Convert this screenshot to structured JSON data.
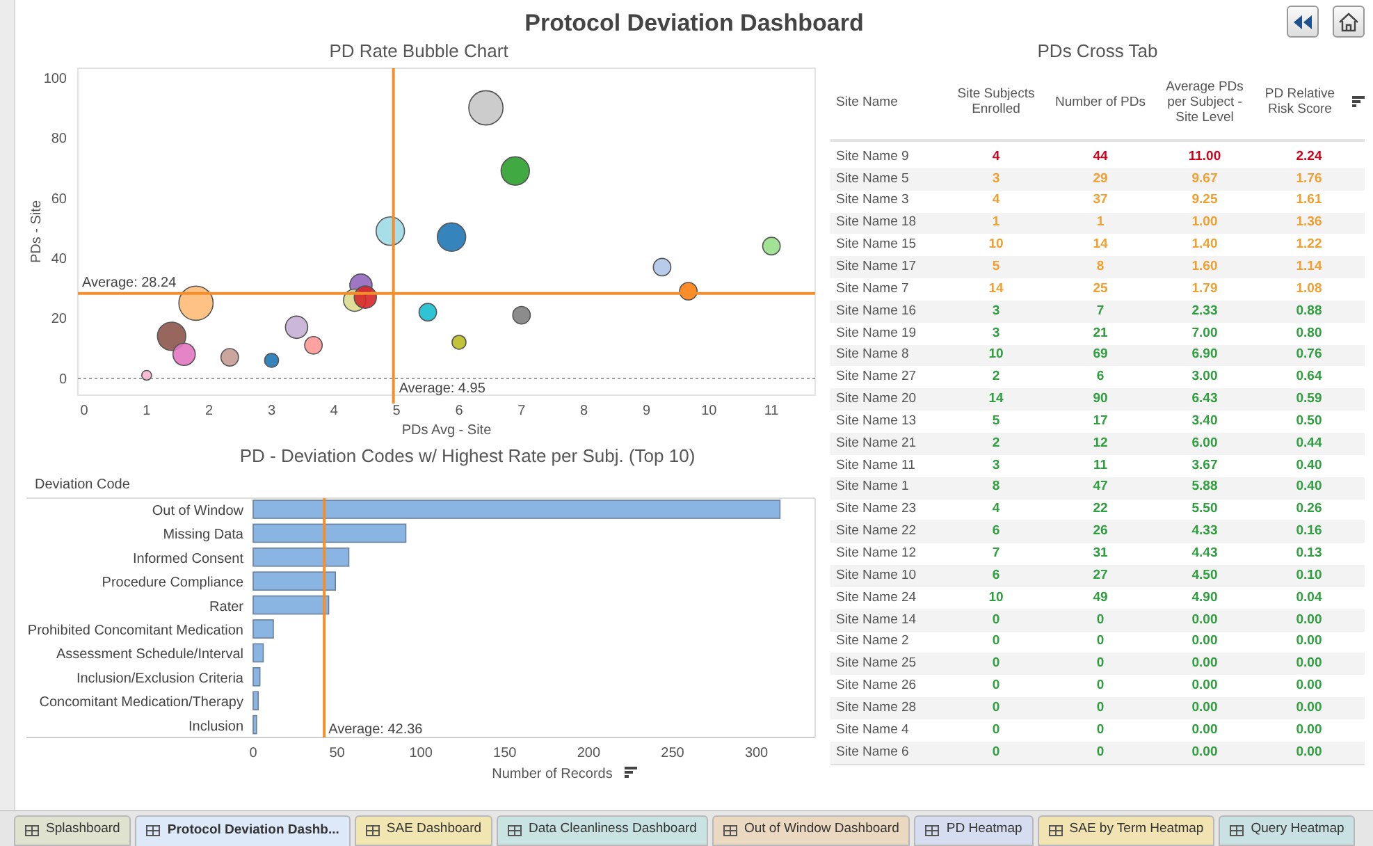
{
  "header": {
    "title": "Protocol Deviation Dashboard"
  },
  "bubble_chart": {
    "bubbles": [
      {
        "kind": "xlarge"
      },
      {
        "kind": "large"
      },
      {
        "kind": "large"
      },
      {
        "kind": "large"
      },
      {
        "kind": "small"
      },
      {
        "kind": "small"
      },
      {
        "kind": "small"
      },
      {
        "kind": "medium"
      },
      {
        "kind": "medium"
      },
      {
        "kind": "medium"
      },
      {
        "kind": "xlarge"
      },
      {
        "kind": "small"
      },
      {
        "kind": "small"
      },
      {
        "kind": "medium"
      },
      {
        "kind": "large"
      },
      {
        "kind": "small"
      },
      {
        "kind": "medium"
      },
      {
        "kind": "small"
      },
      {
        "kind": "tiny"
      },
      {
        "kind": "tiny"
      },
      {
        "kind": "dot"
      }
    ],
    "chart_data": {
      "type": "scatter",
      "title": "PD Rate Bubble Chart",
      "xlabel": "PDs Avg - Site",
      "ylabel": "PDs - Site",
      "xlim": [
        -0.1,
        11.7
      ],
      "ylim": [
        -5.6,
        103.2
      ],
      "xticks": [
        0,
        1,
        2,
        3,
        4,
        5,
        6,
        7,
        8,
        9,
        10,
        11
      ],
      "yticks": [
        0,
        20,
        40,
        60,
        80,
        100
      ],
      "series": [
        {
          "color": "#c7c7c7",
          "x": [
            6.43
          ],
          "values": [
            90
          ]
        },
        {
          "color": "#2ca02c",
          "x": [
            6.9
          ],
          "values": [
            69
          ]
        },
        {
          "color": "#9edae5",
          "x": [
            4.9
          ],
          "values": [
            49
          ]
        },
        {
          "color": "#1f77b4",
          "x": [
            5.88
          ],
          "values": [
            47
          ]
        },
        {
          "color": "#98df8a",
          "x": [
            11
          ],
          "values": [
            44
          ]
        },
        {
          "color": "#aec7e8",
          "x": [
            9.25
          ],
          "values": [
            37
          ]
        },
        {
          "color": "#ff7f0e",
          "x": [
            9.67
          ],
          "values": [
            29
          ]
        },
        {
          "color": "#9467bd",
          "x": [
            4.43
          ],
          "values": [
            31
          ]
        },
        {
          "color": "#dbdb8d",
          "x": [
            4.33
          ],
          "values": [
            26
          ]
        },
        {
          "color": "#d62728",
          "x": [
            4.5
          ],
          "values": [
            27
          ]
        },
        {
          "color": "#ffbb78",
          "x": [
            1.79
          ],
          "values": [
            25
          ]
        },
        {
          "color": "#17becf",
          "x": [
            5.5
          ],
          "values": [
            22
          ]
        },
        {
          "color": "#7f7f7f",
          "x": [
            7
          ],
          "values": [
            21
          ]
        },
        {
          "color": "#c5b0d5",
          "x": [
            3.4
          ],
          "values": [
            17
          ]
        },
        {
          "color": "#8c564b",
          "x": [
            1.4
          ],
          "values": [
            14
          ]
        },
        {
          "color": "#ff9896",
          "x": [
            3.67
          ],
          "values": [
            11
          ]
        },
        {
          "color": "#e377c2",
          "x": [
            1.6
          ],
          "values": [
            8
          ]
        },
        {
          "color": "#c49c94",
          "x": [
            2.33
          ],
          "values": [
            7
          ]
        },
        {
          "color": "#1f77b4",
          "x": [
            3
          ],
          "values": [
            6
          ]
        },
        {
          "color": "#bcbd22",
          "x": [
            6
          ],
          "values": [
            12
          ]
        },
        {
          "color": "#f7b6d2",
          "x": [
            1
          ],
          "values": [
            1
          ]
        }
      ],
      "ref_lines": [
        {
          "axis": "x",
          "value": 4.95,
          "label": "Average: 4.95"
        },
        {
          "axis": "y",
          "value": 28.24,
          "label": "Average: 28.24"
        }
      ]
    }
  },
  "bar_chart": {
    "chart_data": {
      "type": "bar",
      "orientation": "horizontal",
      "title": "PD - Deviation Codes w/ Highest Rate per Subj. (Top 10)",
      "ylabel": "Deviation Code",
      "xlabel": "Number of Records",
      "xlim": [
        0,
        335
      ],
      "xticks": [
        0,
        50,
        100,
        150,
        200,
        250,
        300
      ],
      "categories": [
        "Out of Window",
        "Missing Data",
        "Informed Consent",
        "Procedure Compliance",
        "Rater",
        "Prohibited Concomitant Medication",
        "Assessment Schedule/Interval",
        "Inclusion/Exclusion Criteria",
        "Concomitant Medication/Therapy",
        "Inclusion"
      ],
      "values": [
        314,
        91,
        57,
        49,
        45,
        12,
        6,
        4,
        3,
        2
      ],
      "ref_lines": [
        {
          "axis": "x",
          "value": 42.36,
          "label": "Average: 42.36"
        }
      ]
    }
  },
  "cross_tab": {
    "title": "PDs Cross Tab",
    "columns": [
      "Site Name",
      "Site Subjects Enrolled",
      "Number of PDs",
      "Average PDs per Subject - Site Level",
      "PD Relative Risk Score"
    ],
    "rows": [
      {
        "cells": [
          "Site Name 9",
          "4",
          "44",
          "11.00",
          "2.24"
        ],
        "color": "#d0021b"
      },
      {
        "cells": [
          "Site Name 5",
          "3",
          "29",
          "9.67",
          "1.76"
        ],
        "color": "#f0a030"
      },
      {
        "cells": [
          "Site Name 3",
          "4",
          "37",
          "9.25",
          "1.61"
        ],
        "color": "#f0a030"
      },
      {
        "cells": [
          "Site Name 18",
          "1",
          "1",
          "1.00",
          "1.36"
        ],
        "color": "#f0a030"
      },
      {
        "cells": [
          "Site Name 15",
          "10",
          "14",
          "1.40",
          "1.22"
        ],
        "color": "#f0a030"
      },
      {
        "cells": [
          "Site Name 17",
          "5",
          "8",
          "1.60",
          "1.14"
        ],
        "color": "#f0a030"
      },
      {
        "cells": [
          "Site Name 7",
          "14",
          "25",
          "1.79",
          "1.08"
        ],
        "color": "#f0a030"
      },
      {
        "cells": [
          "Site Name 16",
          "3",
          "7",
          "2.33",
          "0.88"
        ],
        "color": "#2e9e3e"
      },
      {
        "cells": [
          "Site Name 19",
          "3",
          "21",
          "7.00",
          "0.80"
        ],
        "color": "#2e9e3e"
      },
      {
        "cells": [
          "Site Name 8",
          "10",
          "69",
          "6.90",
          "0.76"
        ],
        "color": "#2e9e3e"
      },
      {
        "cells": [
          "Site Name 27",
          "2",
          "6",
          "3.00",
          "0.64"
        ],
        "color": "#2e9e3e"
      },
      {
        "cells": [
          "Site Name 20",
          "14",
          "90",
          "6.43",
          "0.59"
        ],
        "color": "#2e9e3e"
      },
      {
        "cells": [
          "Site Name 13",
          "5",
          "17",
          "3.40",
          "0.50"
        ],
        "color": "#2e9e3e"
      },
      {
        "cells": [
          "Site Name 21",
          "2",
          "12",
          "6.00",
          "0.44"
        ],
        "color": "#2e9e3e"
      },
      {
        "cells": [
          "Site Name 11",
          "3",
          "11",
          "3.67",
          "0.40"
        ],
        "color": "#2e9e3e"
      },
      {
        "cells": [
          "Site Name 1",
          "8",
          "47",
          "5.88",
          "0.40"
        ],
        "color": "#2e9e3e"
      },
      {
        "cells": [
          "Site Name 23",
          "4",
          "22",
          "5.50",
          "0.26"
        ],
        "color": "#2e9e3e"
      },
      {
        "cells": [
          "Site Name 22",
          "6",
          "26",
          "4.33",
          "0.16"
        ],
        "color": "#2e9e3e"
      },
      {
        "cells": [
          "Site Name 12",
          "7",
          "31",
          "4.43",
          "0.13"
        ],
        "color": "#2e9e3e"
      },
      {
        "cells": [
          "Site Name 10",
          "6",
          "27",
          "4.50",
          "0.10"
        ],
        "color": "#2e9e3e"
      },
      {
        "cells": [
          "Site Name 24",
          "10",
          "49",
          "4.90",
          "0.04"
        ],
        "color": "#2e9e3e"
      },
      {
        "cells": [
          "Site Name 14",
          "0",
          "0",
          "0.00",
          "0.00"
        ],
        "color": "#2e9e3e"
      },
      {
        "cells": [
          "Site Name 2",
          "0",
          "0",
          "0.00",
          "0.00"
        ],
        "color": "#2e9e3e"
      },
      {
        "cells": [
          "Site Name 25",
          "0",
          "0",
          "0.00",
          "0.00"
        ],
        "color": "#2e9e3e"
      },
      {
        "cells": [
          "Site Name 26",
          "0",
          "0",
          "0.00",
          "0.00"
        ],
        "color": "#2e9e3e"
      },
      {
        "cells": [
          "Site Name 28",
          "0",
          "0",
          "0.00",
          "0.00"
        ],
        "color": "#2e9e3e"
      },
      {
        "cells": [
          "Site Name 4",
          "0",
          "0",
          "0.00",
          "0.00"
        ],
        "color": "#2e9e3e"
      },
      {
        "cells": [
          "Site Name 6",
          "0",
          "0",
          "0.00",
          "0.00"
        ],
        "color": "#2e9e3e"
      }
    ]
  },
  "tabs": [
    {
      "label": "Splashboard",
      "selected": false,
      "color": "#dfe2cf"
    },
    {
      "label": "Protocol Deviation Dashb...",
      "selected": true,
      "color": "#dde9f8"
    },
    {
      "label": "SAE Dashboard",
      "selected": false,
      "color": "#f1e5b2"
    },
    {
      "label": "Data Cleanliness Dashboard",
      "selected": false,
      "color": "#c9e2e2"
    },
    {
      "label": "Out of Window Dashboard",
      "selected": false,
      "color": "#ead8c0"
    },
    {
      "label": "PD Heatmap",
      "selected": false,
      "color": "#d7ddf0"
    },
    {
      "label": "SAE by Term Heatmap",
      "selected": false,
      "color": "#f2e3b3"
    },
    {
      "label": "Query Heatmap",
      "selected": false,
      "color": "#c9e1e3"
    }
  ]
}
